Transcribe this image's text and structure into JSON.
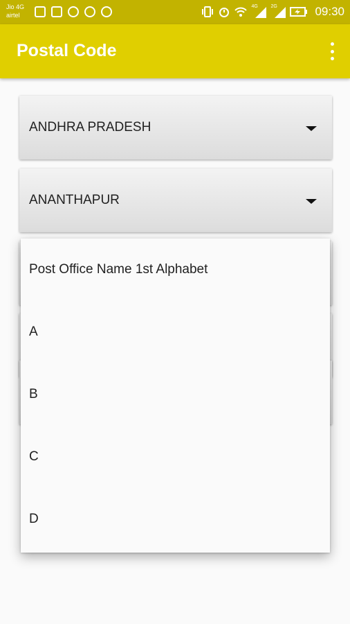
{
  "status_bar": {
    "carrier_1": "Jio 4G",
    "carrier_2": "airtel",
    "notification_icons": [
      "gallery-icon",
      "close-app-icon",
      "whatsapp-icon",
      "phone-icon",
      "play-icon"
    ],
    "system_icons": [
      "vibrate-icon",
      "alarm-icon",
      "wifi-icon",
      "signal-4g-icon",
      "signal-2g-icon",
      "battery-icon"
    ],
    "net_4g": "4G",
    "net_2g": "2G",
    "time": "09:30"
  },
  "app_bar": {
    "title": "Postal Code",
    "menu_icon": "overflow-menu-icon",
    "color": "#e0cf00"
  },
  "spinners": {
    "state": "ANDHRA PRADESH",
    "district": "ANANTHAPUR"
  },
  "dropdown": {
    "items": [
      "Post Office Name 1st Alphabet",
      "A",
      "B",
      "C",
      "D"
    ]
  }
}
